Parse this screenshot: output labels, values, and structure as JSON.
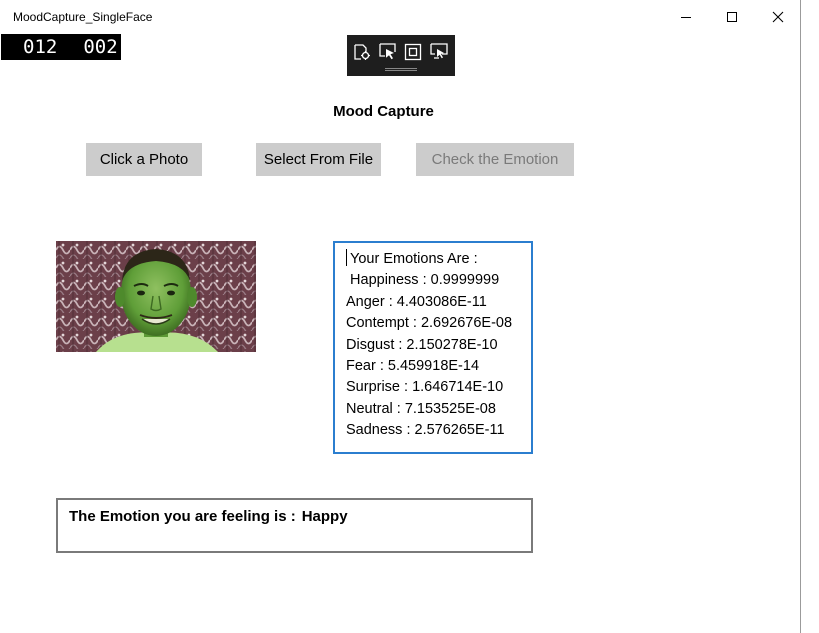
{
  "window": {
    "title": "MoodCapture_SingleFace"
  },
  "counter": {
    "left": "012",
    "right": "002"
  },
  "app": {
    "heading": "Mood Capture"
  },
  "buttons": {
    "click_photo": "Click a Photo",
    "select_file": "Select From File",
    "check_emotion": "Check the Emotion"
  },
  "emotions": {
    "header": "Your Emotions Are :",
    "lines": [
      " Happiness : 0.9999999",
      "Anger : 4.403086E-11",
      "Contempt : 2.692676E-08",
      "Disgust : 2.150278E-10",
      "Fear : 5.459918E-14",
      "Surprise : 1.646714E-10",
      "Neutral : 7.153525E-08",
      "Sadness : 2.576265E-11"
    ]
  },
  "result": {
    "label": "The Emotion you are feeling is :",
    "value": "Happy"
  },
  "colors": {
    "focus_border": "#2b7ecf",
    "button_bg": "#cccccc",
    "debug_toolbar_bg": "#1e1e1e"
  },
  "icons": {
    "debug_toolbar": [
      "live-visual-tree-icon",
      "select-element-icon",
      "display-layout-adorners-icon",
      "track-focus-icon"
    ]
  }
}
